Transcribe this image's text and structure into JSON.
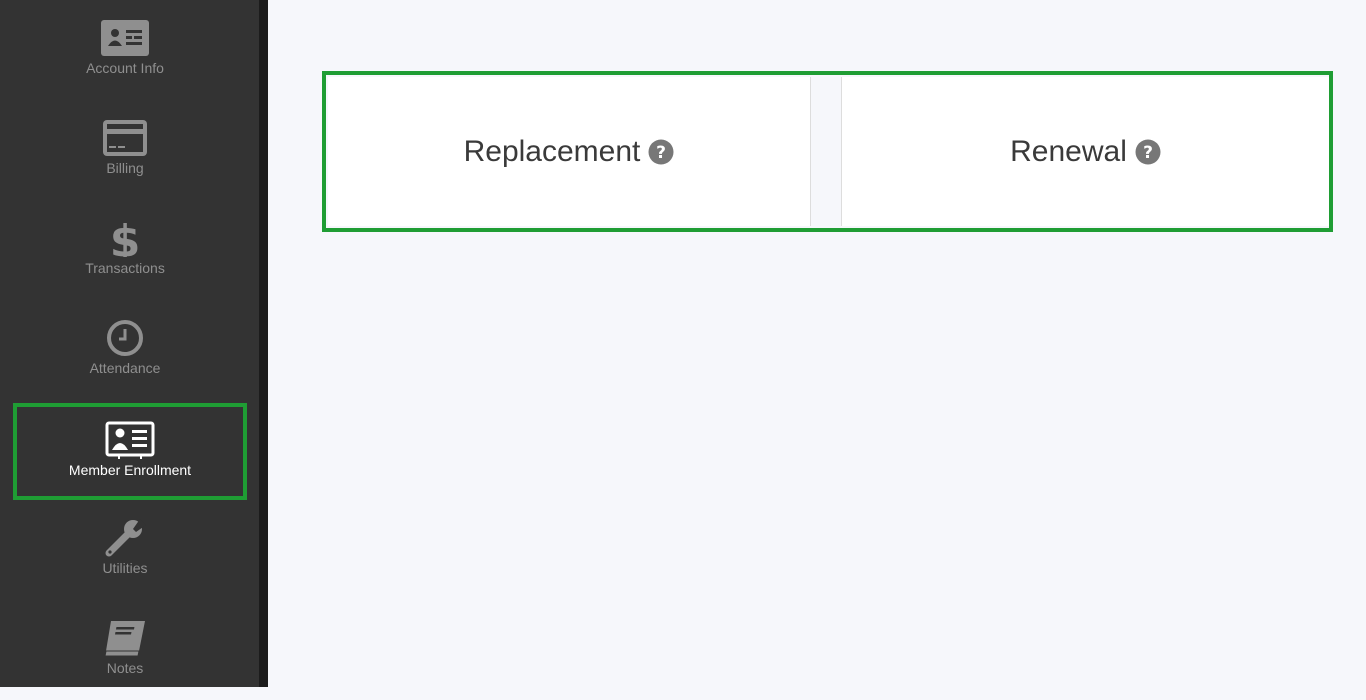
{
  "sidebar": {
    "items": [
      {
        "label": "Account Info",
        "icon": "id-card-icon"
      },
      {
        "label": "Billing",
        "icon": "credit-card-icon"
      },
      {
        "label": "Transactions",
        "icon": "dollar-icon"
      },
      {
        "label": "Attendance",
        "icon": "clock-icon"
      },
      {
        "label": "Member Enrollment",
        "icon": "id-badge-icon",
        "active": true
      },
      {
        "label": "Utilities",
        "icon": "wrench-icon"
      },
      {
        "label": "Notes",
        "icon": "book-icon"
      }
    ]
  },
  "main": {
    "options": [
      {
        "label": "Replacement",
        "icon": "question-circle-icon"
      },
      {
        "label": "Renewal",
        "icon": "question-circle-icon"
      }
    ]
  },
  "colors": {
    "sidebar_bg": "#333333",
    "highlight": "#1f9d34",
    "icon_gray": "#8f8f8f",
    "page_bg": "#f6f7fb"
  }
}
